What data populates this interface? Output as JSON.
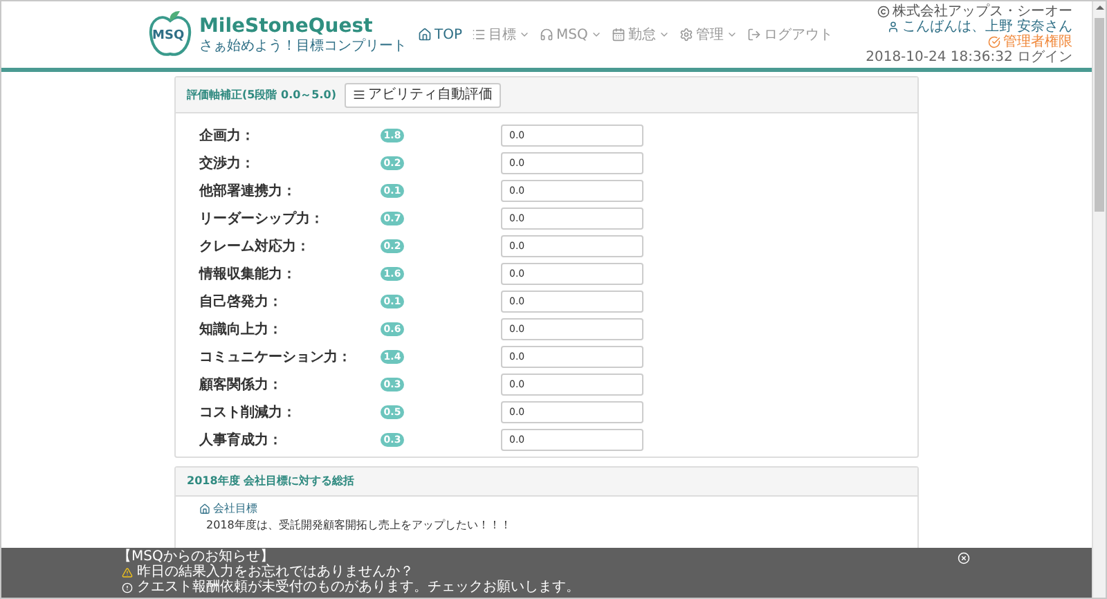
{
  "logo": {
    "mark": "MSQ",
    "title": "MileStoneQuest",
    "tagline": "さぁ始めよう！目標コンプリート"
  },
  "nav": [
    {
      "label": "TOP",
      "dropdown": false,
      "selected": true
    },
    {
      "label": "目標",
      "dropdown": true,
      "selected": false
    },
    {
      "label": "MSQ",
      "dropdown": true,
      "selected": false
    },
    {
      "label": "勤怠",
      "dropdown": true,
      "selected": false
    },
    {
      "label": "管理",
      "dropdown": true,
      "selected": false
    },
    {
      "label": "ログアウト",
      "dropdown": false,
      "selected": false
    }
  ],
  "user": {
    "company": "株式会社アップス・シーオー",
    "greeting": "こんばんは、上野 安奈さん",
    "role": "管理者権限",
    "last_login": "2018-10-24 18:36:32 ログイン"
  },
  "evaluation": {
    "title": "評価軸補正(5段階 0.0～5.0)",
    "button": "アビリティ自動評価",
    "rows": [
      {
        "label": "企画力：",
        "score": "1.8",
        "value": "0.0"
      },
      {
        "label": "交渉力：",
        "score": "0.2",
        "value": "0.0"
      },
      {
        "label": "他部署連携力：",
        "score": "0.1",
        "value": "0.0"
      },
      {
        "label": "リーダーシップ力：",
        "score": "0.7",
        "value": "0.0"
      },
      {
        "label": "クレーム対応力：",
        "score": "0.2",
        "value": "0.0"
      },
      {
        "label": "情報収集能力：",
        "score": "1.6",
        "value": "0.0"
      },
      {
        "label": "自己啓発力：",
        "score": "0.1",
        "value": "0.0"
      },
      {
        "label": "知識向上力：",
        "score": "0.6",
        "value": "0.0"
      },
      {
        "label": "コミュニケーション力：",
        "score": "1.4",
        "value": "0.0"
      },
      {
        "label": "顧客関係力：",
        "score": "0.3",
        "value": "0.0"
      },
      {
        "label": "コスト削減力：",
        "score": "0.5",
        "value": "0.0"
      },
      {
        "label": "人事育成力：",
        "score": "0.3",
        "value": "0.0"
      }
    ]
  },
  "summary": {
    "title": "2018年度 会社目標に対する総括",
    "heading": "会社目標",
    "lines": [
      "2018年度は、受託開発顧客開拓し売上をアップしたい！！！"
    ]
  },
  "notice": {
    "title": "【MSQからのお知らせ】",
    "items": [
      {
        "kind": "warning",
        "text": "昨日の結果入力をお忘れではありませんか？"
      },
      {
        "kind": "info",
        "text": "クエスト報酬依頼が未受付のものがあります。チェックお願いします。"
      }
    ]
  }
}
